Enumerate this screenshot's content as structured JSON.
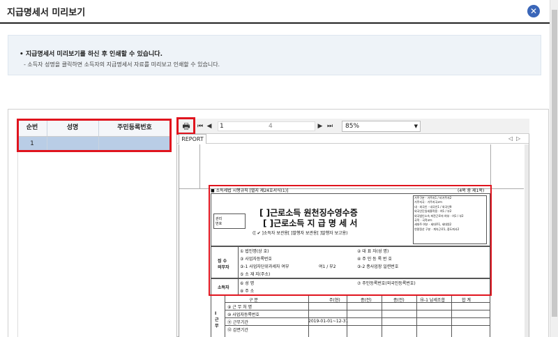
{
  "window": {
    "title": "지급명세서 미리보기",
    "close_icon": "close-icon"
  },
  "notice": {
    "line1": "• 지급명세서 미리보기를 하신 후 인쇄할 수 있습니다.",
    "line2": "- 소득자 성명을 클릭하면 소득자의 지급명세서 자료를 미리보고 인쇄할 수 있습니다."
  },
  "grid": {
    "columns": [
      "순번",
      "성명",
      "주민등록번호"
    ],
    "rows": [
      {
        "seq": "1",
        "name": "",
        "resident_no": ""
      }
    ]
  },
  "viewer": {
    "toolbar": {
      "print_icon": "print-icon",
      "first_icon": "first-page-icon",
      "prev_icon": "prev-page-icon",
      "current_page": "1",
      "total_pages": "4",
      "next_icon": "next-page-icon",
      "last_icon": "last-page-icon",
      "zoom": "85%"
    },
    "tab_label": "REPORT",
    "report": {
      "header_left": "■ 소득세법 시행규칙 [별지 제24호서식(1)]",
      "header_right": "(4쪽 중 제1쪽)",
      "title1": "[  ]근로소득 원천징수영수증",
      "title2": "[  ]근로소득 지 급 명 세 서",
      "subtitle": "([ ✔ ]소득자 보관용[    ]발행자 보관용[    ]발행자 보고용)",
      "mgmt_no_label": "관리\n번호",
      "right_box": [
        "거주구분",
        "거주자1 / 비거주자2",
        "거주지국",
        "거주지국코드",
        "내 · 외국인",
        "내국인1 / 외국인9",
        "외국인단일세율적용",
        "여1 / 부2",
        "외국법인소속 파견근로자 여부",
        "여1 / 부2",
        "국적",
        "국적코드",
        "세대주 여부",
        "세대주1, 세대원2",
        "연말정산 구분",
        "계속근로1, 중도퇴사2"
      ],
      "payer_label": "징 수\n의무자",
      "payer_rows": [
        [
          "① 법인명(상 호)",
          "② 대 표 자(성 명)"
        ],
        [
          "③ 사업자등록번호",
          "④ 주 민 등 록 번 호"
        ],
        [
          "③-1 사업자단위과세자 여부",
          "여1 / 부2",
          "③-2 종사업장 일련번호"
        ],
        [
          "⑤ 소 재 지(주소)",
          ""
        ]
      ],
      "earner_label": "소득자",
      "earner_rows": [
        [
          "⑥ 성          명",
          "⑦ 주민등록번호(외국인등록번호)"
        ],
        [
          "⑧ 주          소",
          ""
        ]
      ],
      "table_header": [
        "구        분",
        "주(현)",
        "종(전)",
        "종(전)",
        "⑯-1 납세조합",
        "합    계"
      ],
      "table_side": "Ⅰ 근 무",
      "table_rows": [
        "⑨ 근 무 처 명",
        "⑩ 사업자등록번호",
        "⑪ 근무기간",
        "⑫ 감면기간"
      ],
      "period_value": "2019-01-01~12-31"
    }
  },
  "colors": {
    "accent": "#3a66b8",
    "highlight_box": "#e0141e",
    "selected_row": "#b9cde6",
    "notice_bg": "#eef3f8"
  }
}
